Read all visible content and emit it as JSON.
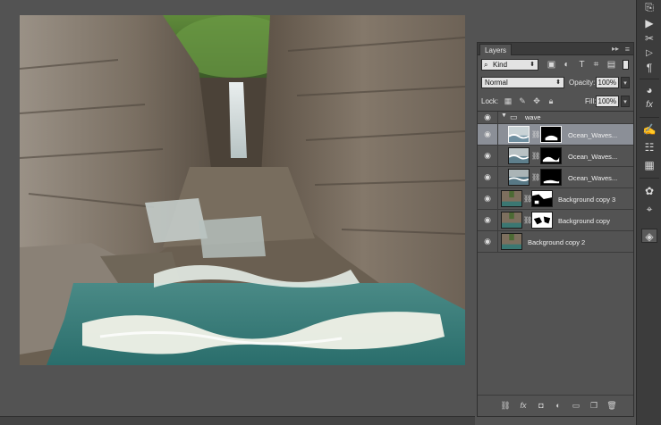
{
  "layers_panel": {
    "tab_label": "Layers",
    "collapse_glyph": "▸▸",
    "menu_glyph": "≡",
    "filter": {
      "selected": "Kind",
      "icons": [
        "image-filter-icon",
        "adjustment-filter-icon",
        "type-filter-icon",
        "shape-filter-icon",
        "smart-object-filter-icon"
      ]
    },
    "blend_mode": "Normal",
    "opacity_label": "Opacity:",
    "opacity_value": "100%",
    "lock_label": "Lock:",
    "lock_icons": [
      "lock-transparent-icon",
      "lock-image-icon",
      "lock-position-icon",
      "lock-all-icon"
    ],
    "fill_label": "Fill:",
    "fill_value": "100%",
    "layers": [
      {
        "name": "wave",
        "type": "group",
        "expanded": true,
        "visible": true
      },
      {
        "name": "Ocean_Waves...",
        "type": "layer",
        "has_mask": true,
        "selected": true,
        "visible": true
      },
      {
        "name": "Ocean_Waves...",
        "type": "layer",
        "has_mask": true,
        "selected": false,
        "visible": true
      },
      {
        "name": "Ocean_Waves...",
        "type": "layer",
        "has_mask": true,
        "selected": false,
        "visible": true
      },
      {
        "name": "Background copy 3",
        "type": "layer",
        "has_mask": true,
        "selected": false,
        "visible": true
      },
      {
        "name": "Background copy",
        "type": "layer",
        "has_mask": true,
        "selected": false,
        "visible": true
      },
      {
        "name": "Background copy 2",
        "type": "layer",
        "has_mask": false,
        "selected": false,
        "visible": true
      }
    ],
    "footer_icons": [
      "link-layers-icon",
      "fx-icon",
      "add-mask-icon",
      "adjustment-layer-icon",
      "new-group-icon",
      "new-layer-icon",
      "delete-layer-icon"
    ]
  },
  "right_toolbar": {
    "tools": [
      "history-icon",
      "play-icon",
      "tools-icon",
      "play-small-icon",
      "paragraph-icon",
      "color-icon",
      "fx-styles-icon",
      "brush-icon",
      "adjust-icon",
      "swatches-icon",
      "channels-icon",
      "paths-icon",
      "layers-icon"
    ]
  },
  "colors": {
    "ui_background": "#535353",
    "panel_dark": "#3c3c3c",
    "selected_row": "#8b8f97",
    "water": "#2f7b78"
  }
}
